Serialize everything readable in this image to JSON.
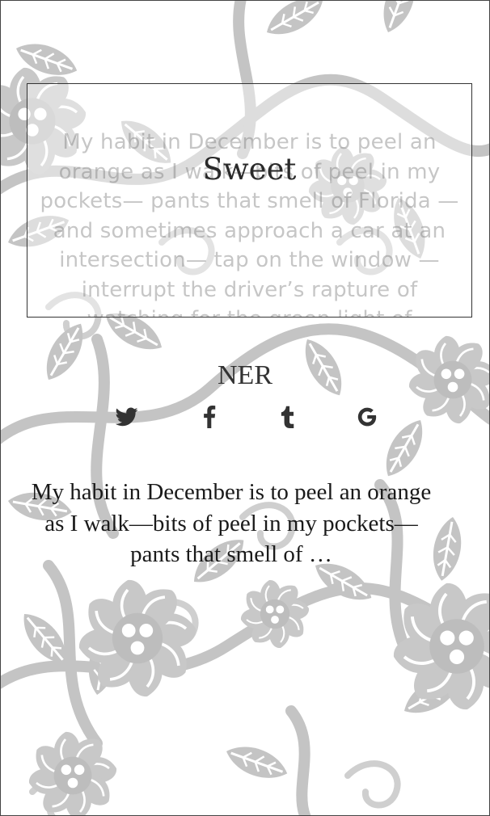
{
  "poem_card": {
    "title": "Sweet",
    "excerpt_full": "My habit in December is to peel an orange as I walk—bits of peel in my pockets— pants that smell of Florida —and sometimes approach a car at an intersection— tap on the window —interrupt the driver’s rapture of watching for the green light of"
  },
  "author": "NER",
  "share": [
    {
      "icon": "twitter-icon"
    },
    {
      "icon": "facebook-icon"
    },
    {
      "icon": "tumblr-icon"
    },
    {
      "icon": "google-icon"
    }
  ],
  "excerpt": "My habit in December is to peel an orange as I walk—bits of peel in my pockets— pants that smell of …",
  "colors": {
    "pattern": "#c4c4c4",
    "text": "#1a1a1a",
    "icon": "#333333"
  }
}
